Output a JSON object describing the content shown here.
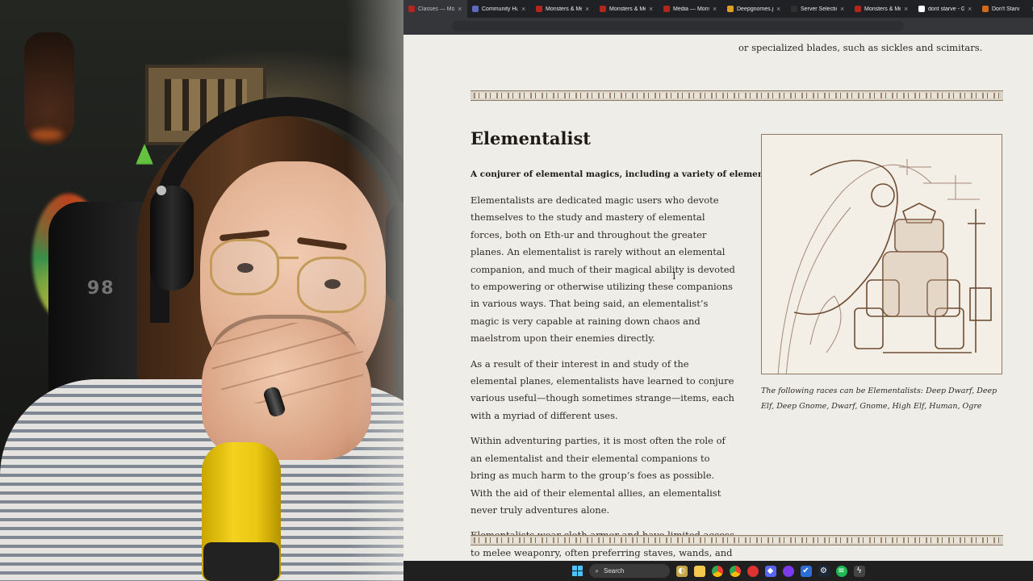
{
  "browser": {
    "tabs": [
      {
        "title": "Classes — Mons",
        "active": true,
        "favicon_color": "#b3261e"
      },
      {
        "title": "Community Hub",
        "active": false,
        "favicon_color": "#5c6bc0"
      },
      {
        "title": "Monsters & Me",
        "active": false,
        "favicon_color": "#b3261e"
      },
      {
        "title": "Monsters & Me",
        "active": false,
        "favicon_color": "#b3261e"
      },
      {
        "title": "Media — Monst",
        "active": false,
        "favicon_color": "#b3261e"
      },
      {
        "title": "Deepgnomes.jp",
        "active": false,
        "favicon_color": "#e0a023"
      },
      {
        "title": "Server Selection",
        "active": false,
        "favicon_color": "#2f2f2f"
      },
      {
        "title": "Monsters & Me",
        "active": false,
        "favicon_color": "#b3261e"
      },
      {
        "title": "dont starve - G",
        "active": false,
        "favicon_color": "#ffffff"
      },
      {
        "title": "Don't Starv",
        "active": false,
        "favicon_color": "#d2691e"
      }
    ],
    "tab_close_glyph": "×"
  },
  "page": {
    "top_fragment": "or specialized blades, such as sickles and scimitars.",
    "section_title": "Elementalist",
    "lead": "A conjurer of elemental magics, including a variety of elemental pets.",
    "paragraphs": [
      "Elementalists are dedicated magic users who devote themselves to the study and mastery of elemental forces, both on Eth-ur and throughout the greater planes. An elementalist is rarely without an elemental companion, and much of their magical ability is devoted to empowering or otherwise utilizing these companions in various ways. That being said, an elementalist’s magic is very capable at raining down chaos and maelstrom upon their enemies directly.",
      "As a result of their interest in and study of the elemental planes, elementalists have learned to conjure various useful—though sometimes strange—items, each with a myriad of different uses.",
      "Within adventuring parties, it is most often the role of an elementalist and their elemental companions to bring as much harm to the group’s foes as possible. With the aid of their elemental allies, an elementalist never truly adventures alone.",
      "Elementalists wear cloth armor and have limited access to melee weaponry, often preferring staves, wands, and daggers."
    ],
    "caption": "The following races can be Elementalists: Deep Dwarf, Deep Elf, Deep Gnome, Dwarf, Gnome, High Elf, Human, Ogre",
    "illustration_icon": "elementalist-illustration"
  },
  "taskbar": {
    "search_label": "Search",
    "icons": [
      "windows-start-icon",
      "search-icon",
      "widgets-icon",
      "file-explorer-icon",
      "chrome-icon",
      "chrome-icon",
      "app-icon",
      "app-icon",
      "app-icon",
      "app-icon",
      "steam-icon",
      "spotify-icon",
      "app-icon"
    ]
  },
  "webcam": {
    "chair_logo": "98"
  },
  "colors": {
    "page_bg": "#efede7",
    "text": "#2e2a25",
    "tabbar": "#202124",
    "taskbar": "#202020",
    "accent_windows": "#4cc2ff"
  }
}
